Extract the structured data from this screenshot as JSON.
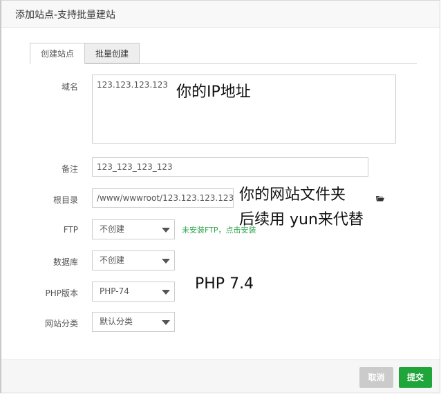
{
  "dialog": {
    "title": "添加站点-支持批量建站"
  },
  "tabs": [
    {
      "label": "创建站点"
    },
    {
      "label": "批量创建"
    }
  ],
  "form": {
    "domain": {
      "label": "域名",
      "value": "123.123.123.123"
    },
    "remark": {
      "label": "备注",
      "value": "123_123_123_123"
    },
    "root": {
      "label": "根目录",
      "value": "/www/wwwroot/123.123.123.123"
    },
    "ftp": {
      "label": "FTP",
      "value": "不创建",
      "note": "未安装FTP，点击安装"
    },
    "database": {
      "label": "数据库",
      "value": "不创建"
    },
    "php": {
      "label": "PHP版本",
      "value": "PHP-74"
    },
    "category": {
      "label": "网站分类",
      "value": "默认分类"
    }
  },
  "annotations": {
    "ip": "你的IP地址",
    "folder_line1": "你的网站文件夹",
    "folder_line2": "后续用 yun来代替",
    "php": "PHP 7.4"
  },
  "footer": {
    "cancel_label": "取消",
    "submit_label": "提交"
  },
  "colors": {
    "primary": "#20a53a",
    "note": "#2fa84f",
    "cancel_disabled": "#cbcbcb"
  }
}
